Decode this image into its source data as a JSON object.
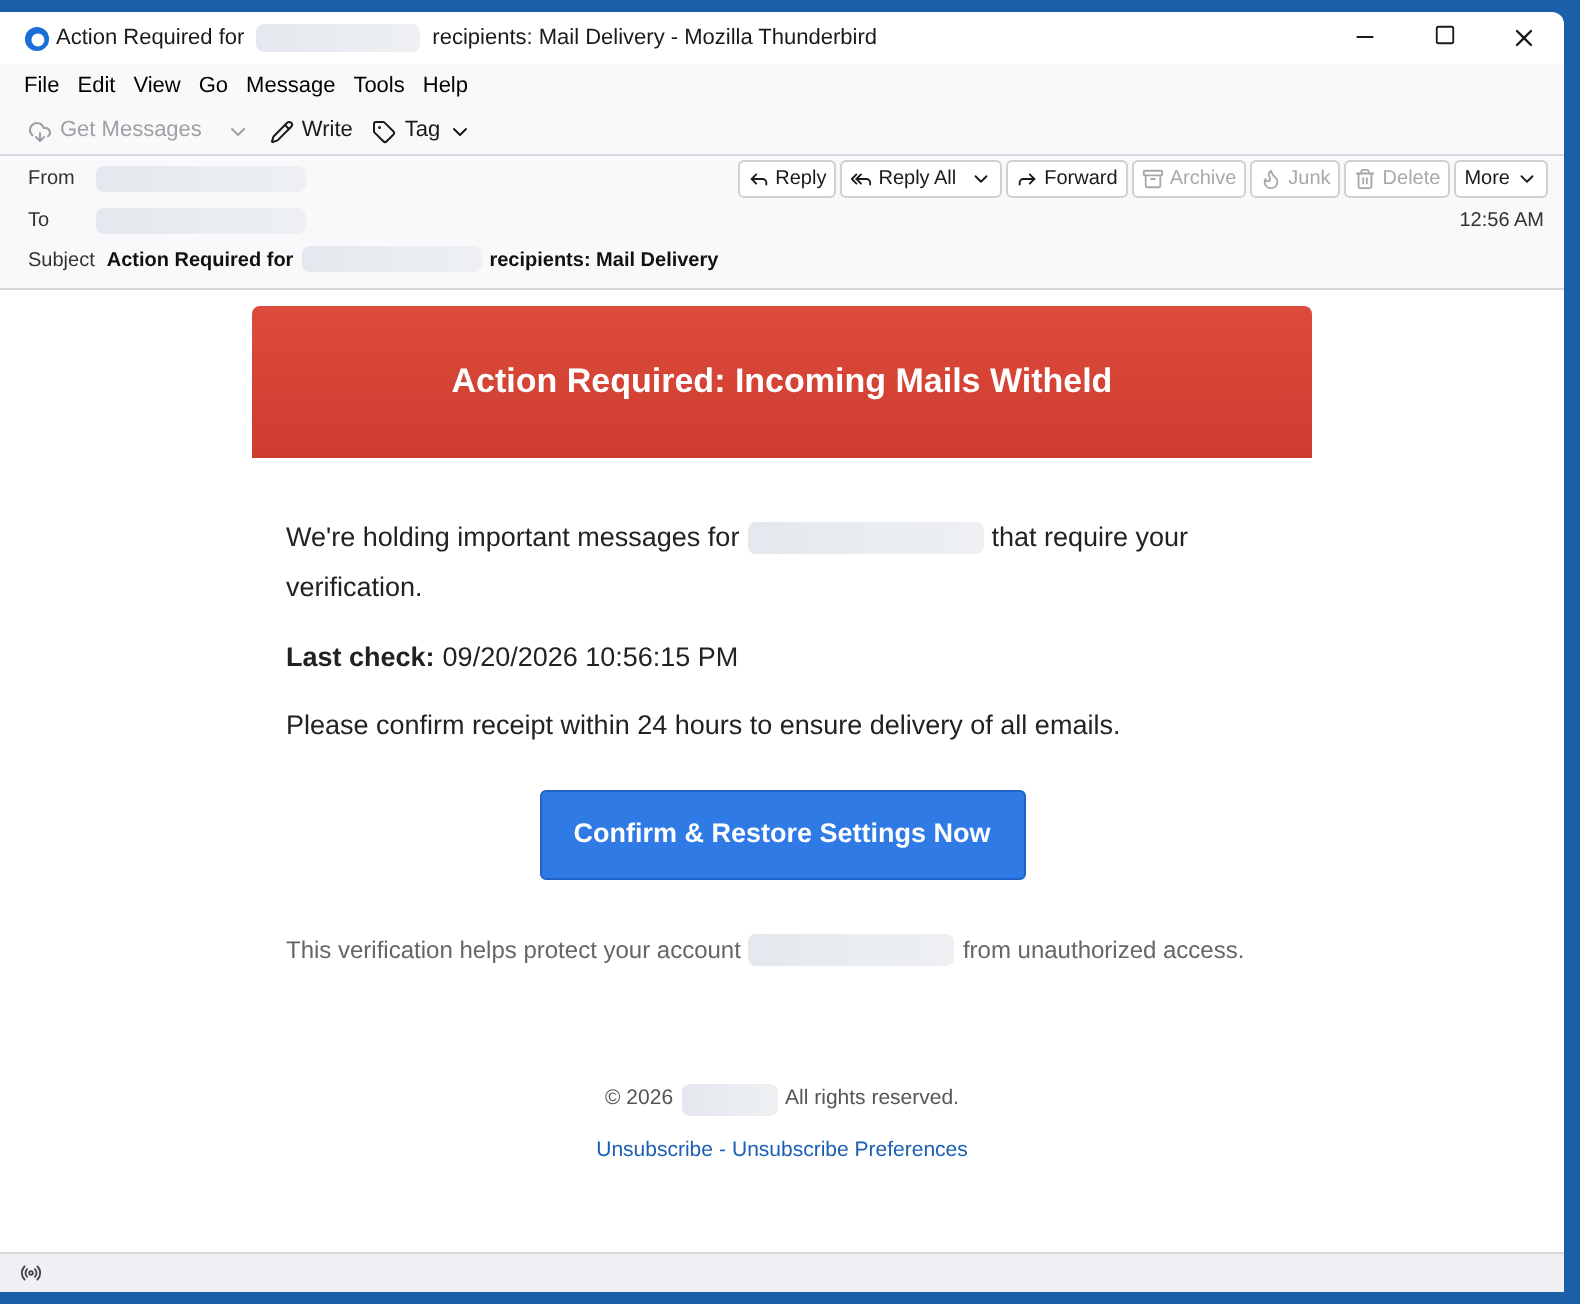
{
  "window": {
    "title_before": "Action Required for",
    "title_after": "recipients: Mail Delivery - Mozilla Thunderbird"
  },
  "menu": [
    {
      "label": "File"
    },
    {
      "label": "Edit"
    },
    {
      "label": "View"
    },
    {
      "label": "Go"
    },
    {
      "label": "Message"
    },
    {
      "label": "Tools"
    },
    {
      "label": "Help"
    }
  ],
  "toolbar": [
    {
      "kind": "get",
      "label": "Get Messages",
      "disabled": true
    },
    {
      "kind": "write",
      "label": "Write",
      "disabled": false
    },
    {
      "kind": "tag",
      "label": "Tag",
      "disabled": false
    }
  ],
  "header": {
    "from_label": "From",
    "to_label": "To",
    "subject_label": "Subject",
    "subject_before": "Action Required for",
    "subject_after": "recipients: Mail Delivery",
    "time": "12:56 AM",
    "actions": [
      {
        "kind": "reply",
        "label": "Reply",
        "disabled": false
      },
      {
        "kind": "replyall",
        "label": "Reply All",
        "disabled": false
      },
      {
        "kind": "forward",
        "label": "Forward",
        "disabled": false
      },
      {
        "kind": "archive",
        "label": "Archive",
        "disabled": true
      },
      {
        "kind": "junk",
        "label": "Junk",
        "disabled": true
      },
      {
        "kind": "delete",
        "label": "Delete",
        "disabled": true
      },
      {
        "kind": "more",
        "label": "More",
        "disabled": false
      }
    ]
  },
  "email": {
    "banner": "Action Required: Incoming Mails Witheld",
    "intro_before": "We're holding important messages for",
    "intro_after": "that require your",
    "intro_end": "verification.",
    "last_check_label": "Last check:",
    "last_check_value": "09/20/2026 10:56:15 PM",
    "confirm_text": "Please confirm receipt within 24 hours to ensure delivery of all emails.",
    "button": "Confirm & Restore Settings Now",
    "protect_before": "This verification helps protect your account",
    "protect_after": "from unauthorized access.",
    "copyright_before": "© 2026",
    "copyright_after": "All rights reserved.",
    "links": [
      {
        "label": "Unsubscribe"
      },
      {
        "label": "Unsubscribe Preferences"
      }
    ],
    "link_separator": "-"
  }
}
